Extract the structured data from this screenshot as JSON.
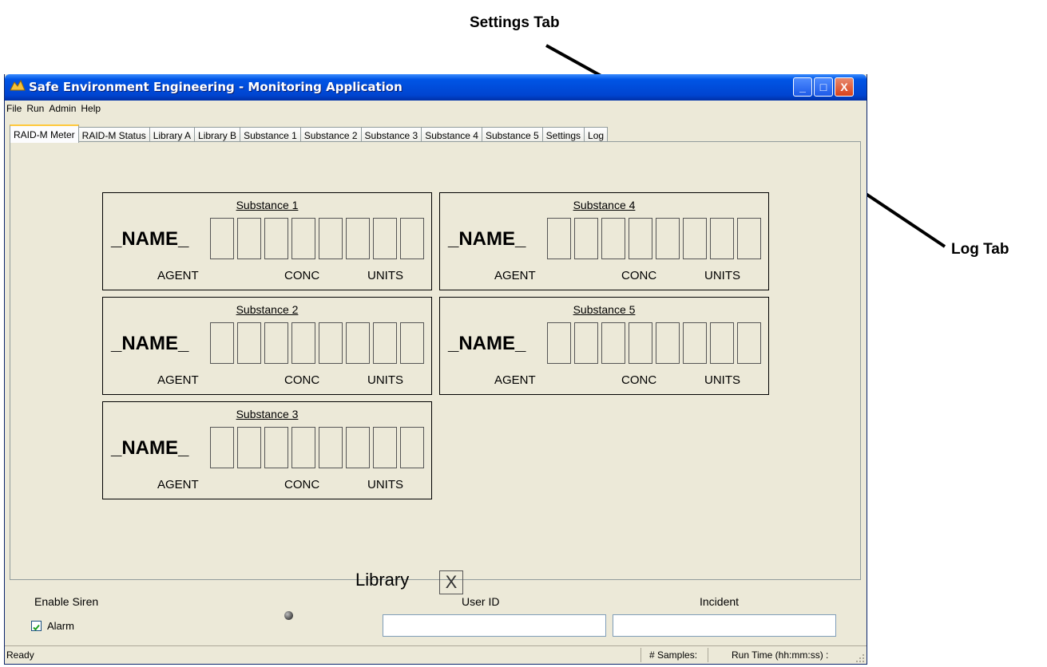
{
  "annotations": {
    "settings_tab": "Settings Tab",
    "log_tab": "Log Tab"
  },
  "window": {
    "title": "Safe Environment Engineering - Monitoring Application",
    "minimize_label": "_",
    "maximize_label": "□",
    "close_label": "X"
  },
  "menu": [
    "File",
    "Run",
    "Admin",
    "Help"
  ],
  "tabs": [
    "RAID-M Meter",
    "RAID-M Status",
    "Library A",
    "Library B",
    "Substance 1",
    "Substance 2",
    "Substance 3",
    "Substance 4",
    "Substance 5",
    "Settings",
    "Log"
  ],
  "active_tab": "RAID-M Meter",
  "substances": [
    {
      "title": "Substance 1",
      "name": "_NAME_",
      "agent": "AGENT",
      "conc": "CONC",
      "units": "UNITS"
    },
    {
      "title": "Substance 2",
      "name": "_NAME_",
      "agent": "AGENT",
      "conc": "CONC",
      "units": "UNITS"
    },
    {
      "title": "Substance 3",
      "name": "_NAME_",
      "agent": "AGENT",
      "conc": "CONC",
      "units": "UNITS"
    },
    {
      "title": "Substance 4",
      "name": "_NAME_",
      "agent": "AGENT",
      "conc": "CONC",
      "units": "UNITS"
    },
    {
      "title": "Substance 5",
      "name": "_NAME_",
      "agent": "AGENT",
      "conc": "CONC",
      "units": "UNITS"
    }
  ],
  "library": {
    "label": "Library",
    "value": "X"
  },
  "bottom": {
    "enable_siren": "Enable Siren",
    "alarm_label": "Alarm",
    "alarm_checked": true,
    "user_id_label": "User ID",
    "user_id_value": "",
    "incident_label": "Incident",
    "incident_value": ""
  },
  "status": {
    "state": "Ready",
    "samples": "# Samples:",
    "run_time": "Run Time (hh:mm:ss) :"
  }
}
